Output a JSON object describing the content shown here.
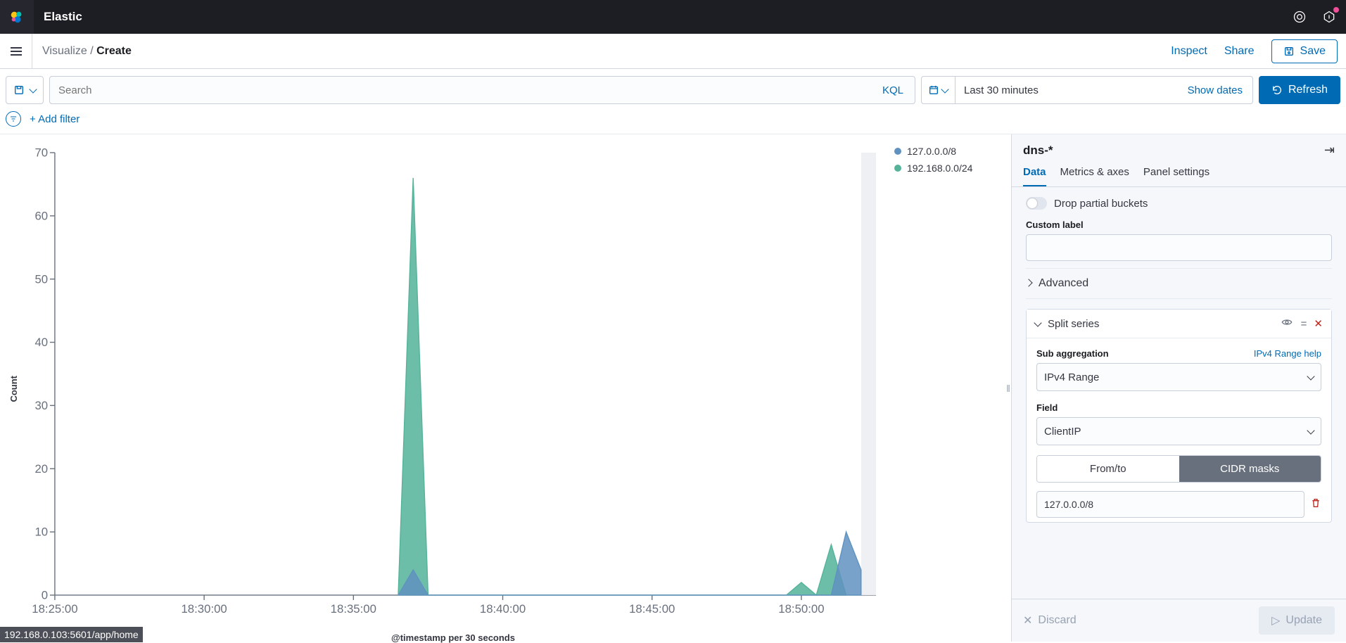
{
  "brand": "Elastic",
  "breadcrumb": {
    "parent": "Visualize",
    "current": "Create"
  },
  "topActions": {
    "inspect": "Inspect",
    "share": "Share",
    "save": "Save"
  },
  "search": {
    "placeholder": "Search",
    "kql": "KQL"
  },
  "timepicker": {
    "range": "Last 30 minutes",
    "showDates": "Show dates"
  },
  "refresh": "Refresh",
  "addFilter": "+ Add filter",
  "chart": {
    "ylabel": "Count",
    "xlabel": "@timestamp per 30 seconds",
    "legend": [
      {
        "label": "127.0.0.0/8",
        "color": "#6092c0"
      },
      {
        "label": "192.168.0.0/24",
        "color": "#54b399"
      }
    ]
  },
  "chart_data": {
    "type": "area",
    "xlabel": "@timestamp per 30 seconds",
    "ylabel": "Count",
    "ylim": [
      0,
      70
    ],
    "x_ticks": [
      "18:25:00",
      "18:30:00",
      "18:35:00",
      "18:40:00",
      "18:45:00",
      "18:50:00"
    ],
    "y_ticks": [
      0,
      10,
      20,
      30,
      40,
      50,
      60,
      70
    ],
    "series": [
      {
        "name": "127.0.0.0/8",
        "color": "#6092c0",
        "points": [
          {
            "x": "18:36:30",
            "y": 0
          },
          {
            "x": "18:37:00",
            "y": 4
          },
          {
            "x": "18:37:30",
            "y": 0
          },
          {
            "x": "18:51:00",
            "y": 0
          },
          {
            "x": "18:51:30",
            "y": 10
          },
          {
            "x": "18:52:00",
            "y": 4
          }
        ]
      },
      {
        "name": "192.168.0.0/24",
        "color": "#54b399",
        "points": [
          {
            "x": "18:36:30",
            "y": 0
          },
          {
            "x": "18:37:00",
            "y": 66
          },
          {
            "x": "18:37:30",
            "y": 0
          },
          {
            "x": "18:49:30",
            "y": 0
          },
          {
            "x": "18:50:00",
            "y": 2
          },
          {
            "x": "18:50:30",
            "y": 0
          },
          {
            "x": "18:51:00",
            "y": 8
          },
          {
            "x": "18:51:30",
            "y": 0
          }
        ]
      }
    ]
  },
  "panel": {
    "indexPattern": "dns-*",
    "tabs": {
      "data": "Data",
      "metrics": "Metrics & axes",
      "settings": "Panel settings"
    },
    "dropPartial": "Drop partial buckets",
    "customLabel": "Custom label",
    "customLabelValue": "",
    "advanced": "Advanced",
    "splitSeries": "Split series",
    "subAgg": "Sub aggregation",
    "subAggHelp": "IPv4 Range help",
    "subAggValue": "IPv4 Range",
    "field": "Field",
    "fieldValue": "ClientIP",
    "rangeModes": {
      "fromto": "From/to",
      "cidr": "CIDR masks"
    },
    "cidrValue": "127.0.0.0/8"
  },
  "footer": {
    "discard": "Discard",
    "update": "Update"
  },
  "statusUrl": "192.168.0.103:5601/app/home"
}
